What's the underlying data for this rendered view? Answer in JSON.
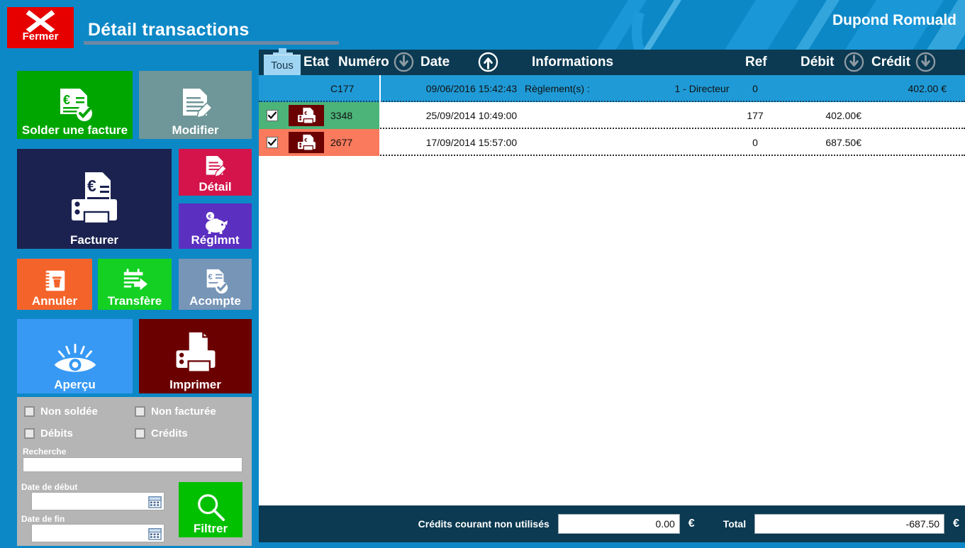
{
  "header": {
    "close_label": "Fermer",
    "close_icon": "close-x-icon",
    "title": "Détail transactions",
    "user": "Dupond Romuald"
  },
  "sidebar": {
    "buttons": [
      {
        "key": "solder",
        "label": "Solder une facture",
        "icon": "invoice-check-icon",
        "color": "#00a600"
      },
      {
        "key": "modifier",
        "label": "Modifier",
        "icon": "document-pencil-icon",
        "color": "#6f9698"
      },
      {
        "key": "facturer",
        "label": "Facturer",
        "icon": "invoice-printer-icon",
        "color": "#1b2250"
      },
      {
        "key": "detail",
        "label": "Détail",
        "icon": "document-pencil-icon",
        "color": "#d4144a"
      },
      {
        "key": "reglmnt",
        "label": "Réglmnt",
        "icon": "piggy-bank-euro-icon",
        "color": "#5b2fc0"
      },
      {
        "key": "annuler",
        "label": "Annuler",
        "icon": "notebook-trash-icon",
        "color": "#f4642a"
      },
      {
        "key": "transfere",
        "label": "Transfère",
        "icon": "calendar-arrow-icon",
        "color": "#13d023"
      },
      {
        "key": "acompte",
        "label": "Acompte",
        "icon": "euro-document-check-icon",
        "color": "#7695b7"
      },
      {
        "key": "apercu",
        "label": "Aperçu",
        "icon": "eye-icon",
        "color": "#3799f4"
      },
      {
        "key": "imprimer",
        "label": "Imprimer",
        "icon": "printer-icon",
        "color": "#6b0001"
      }
    ],
    "filters": {
      "checkboxes": [
        {
          "key": "non_soldee",
          "label": "Non soldée",
          "checked": false
        },
        {
          "key": "non_facturee",
          "label": "Non facturée",
          "checked": false
        },
        {
          "key": "debits",
          "label": "Débits",
          "checked": false
        },
        {
          "key": "credits",
          "label": "Crédits",
          "checked": false
        }
      ],
      "search_label": "Recherche",
      "search_value": "",
      "date_start_label": "Date de début",
      "date_start_value": "",
      "date_end_label": "Date de fin",
      "date_end_value": "",
      "calendar_icon": "calendar-icon",
      "filter_button_label": "Filtrer",
      "filter_button_icon": "magnifier-icon"
    }
  },
  "grid": {
    "select_all_tab": "Tous",
    "columns": [
      {
        "key": "etat",
        "label": "Etat",
        "sort": "none"
      },
      {
        "key": "num",
        "label": "Numéro",
        "sort": "desc"
      },
      {
        "key": "date",
        "label": "Date",
        "sort": "asc"
      },
      {
        "key": "info",
        "label": "Informations",
        "sort": "none"
      },
      {
        "key": "ref",
        "label": "Ref",
        "sort": "none"
      },
      {
        "key": "debit",
        "label": "Débit",
        "sort": "desc"
      },
      {
        "key": "credit",
        "label": "Crédit",
        "sort": "desc"
      }
    ],
    "rows": [
      {
        "checked": false,
        "show_icon": false,
        "tint": "none",
        "numero": "C177",
        "date": "09/06/2016 15:42:43",
        "informations": "Règlement(s) :",
        "user": "1 - Directeur",
        "ref": "0",
        "debit": "",
        "credit": "402.00 €"
      },
      {
        "checked": true,
        "show_icon": true,
        "tint": "green",
        "numero": "3348",
        "date": "25/09/2014 10:49:00",
        "informations": "",
        "user": "",
        "ref": "177",
        "debit": "402.00€",
        "credit": ""
      },
      {
        "checked": true,
        "show_icon": true,
        "tint": "salmon",
        "numero": "2677",
        "date": "17/09/2014 15:57:00",
        "informations": "",
        "user": "",
        "ref": "0",
        "debit": "687.50€",
        "credit": ""
      }
    ]
  },
  "footer": {
    "credits_label": "Crédits courant non utilisés",
    "credits_value": "0.00",
    "credits_currency": "€",
    "total_label": "Total",
    "total_value": "-687.50",
    "total_currency": "€"
  },
  "colors": {
    "brand_blue": "#0d88c6",
    "dark_navy": "#0b3a52",
    "row_selected": "#1f9ad6",
    "tint_green": "#4cb479",
    "tint_salmon": "#f97a5c"
  }
}
